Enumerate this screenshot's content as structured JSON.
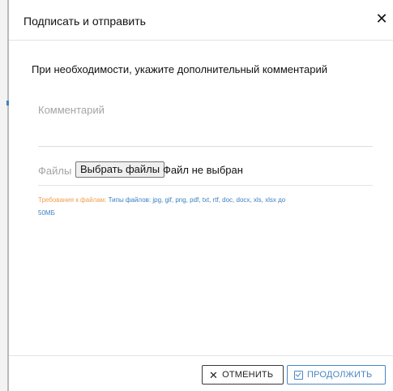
{
  "dialog": {
    "title": "Подписать и отправить",
    "close_icon": "close-icon",
    "hint": "При необходимости, укажите дополнительный комментарий",
    "comment": {
      "placeholder": "Комментарий",
      "value": ""
    },
    "files": {
      "label": "Файлы",
      "choose_button": "Выбрать файлы",
      "status": "Файл не выбран"
    },
    "requirements": {
      "label": "Требования к файлам:",
      "types": "Типы файлов: jpg, gif, png, pdf, txt, rtf, doc, docx, xls, xlsx до",
      "size": "50МБ"
    },
    "buttons": {
      "cancel_icon": "close-icon",
      "cancel": "ОТМЕНИТЬ",
      "continue_icon": "checkbox-check-icon",
      "continue": "ПРОДОЛЖИТЬ"
    }
  },
  "colors": {
    "accent": "#4a86c5",
    "warning_label": "#f0a050",
    "muted_text": "#a4a4a4"
  }
}
